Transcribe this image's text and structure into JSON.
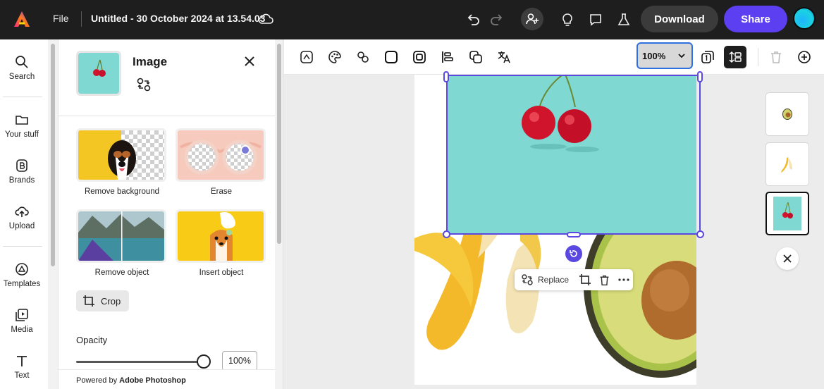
{
  "topbar": {
    "file_label": "File",
    "doc_title": "Untitled - 30 October 2024 at 13.54.03",
    "download_label": "Download",
    "share_label": "Share",
    "brand_color": "#5c3ff0"
  },
  "rail": {
    "items": [
      {
        "label": "Search",
        "icon": "search-icon"
      },
      {
        "label": "Your stuff",
        "icon": "folder-icon"
      },
      {
        "label": "Brands",
        "icon": "brand-icon"
      },
      {
        "label": "Upload",
        "icon": "upload-icon"
      },
      {
        "label": "Templates",
        "icon": "templates-icon"
      },
      {
        "label": "Media",
        "icon": "media-icon"
      },
      {
        "label": "Text",
        "icon": "text-icon"
      }
    ]
  },
  "panel": {
    "title": "Image",
    "tools": [
      {
        "label": "Remove background"
      },
      {
        "label": "Erase"
      },
      {
        "label": "Remove object"
      },
      {
        "label": "Insert object"
      }
    ],
    "crop_label": "Crop",
    "opacity_label": "Opacity",
    "opacity_value": "100%",
    "opacity_level": 1.0,
    "powered_prefix": "Powered by ",
    "powered_brand": "Adobe Photoshop"
  },
  "canvas_toolbar": {
    "zoom_value": "100%"
  },
  "context_menu": {
    "replace_label": "Replace"
  }
}
